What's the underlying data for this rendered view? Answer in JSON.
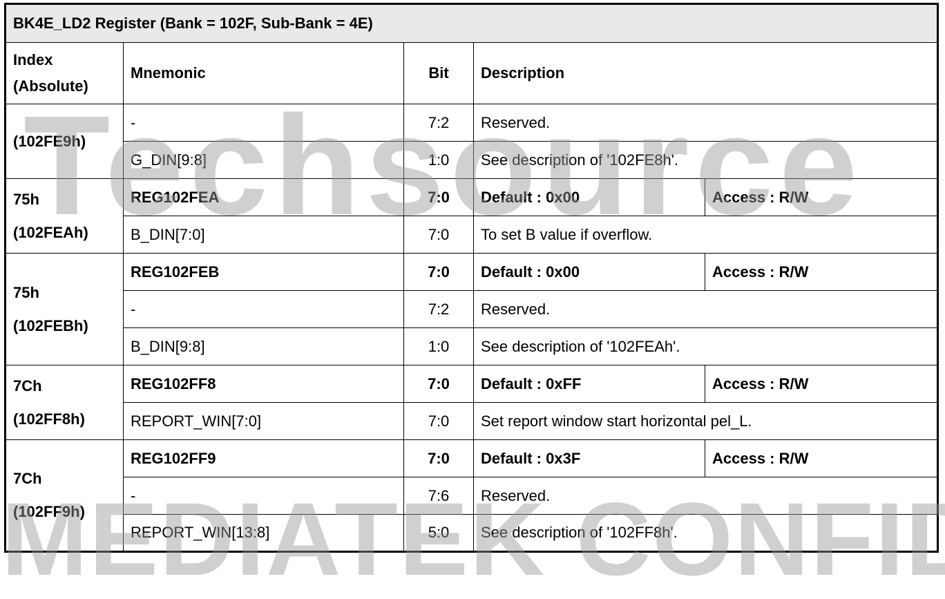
{
  "title": "BK4E_LD2 Register (Bank = 102F, Sub-Bank = 4E)",
  "headers": {
    "index_line1": "Index",
    "index_line2": "(Absolute)",
    "mnemonic": "Mnemonic",
    "bit": "Bit",
    "description": "Description"
  },
  "rows": [
    {
      "mnemonic": "-",
      "bit": "7:2",
      "desc": "Reserved."
    },
    {
      "mnemonic": "G_DIN[9:8]",
      "bit": "1:0",
      "desc": "See description of '102FE8h'."
    },
    {
      "mnemonic": "REG102FEA",
      "bit": "7:0",
      "default": "Default : 0x00",
      "access": "Access : R/W"
    },
    {
      "mnemonic": "B_DIN[7:0]",
      "bit": "7:0",
      "desc": "To set B value if overflow."
    },
    {
      "mnemonic": "REG102FEB",
      "bit": "7:0",
      "default": "Default : 0x00",
      "access": "Access : R/W"
    },
    {
      "mnemonic": "-",
      "bit": "7:2",
      "desc": "Reserved."
    },
    {
      "mnemonic": "B_DIN[9:8]",
      "bit": "1:0",
      "desc": "See description of '102FEAh'."
    },
    {
      "mnemonic": "REG102FF8",
      "bit": "7:0",
      "default": "Default : 0xFF",
      "access": "Access : R/W"
    },
    {
      "mnemonic": "REPORT_WIN[7:0]",
      "bit": "7:0",
      "desc": "Set report window start horizontal pel_L."
    },
    {
      "mnemonic": "REG102FF9",
      "bit": "7:0",
      "default": "Default : 0x3F",
      "access": "Access : R/W"
    },
    {
      "mnemonic": "-",
      "bit": "7:6",
      "desc": "Reserved."
    },
    {
      "mnemonic": "REPORT_WIN[13:8]",
      "bit": "5:0",
      "desc": "See description of '102FF8h'."
    }
  ],
  "indexes": [
    {
      "line1": "(102FE9h)",
      "line2": ""
    },
    {
      "line1": "75h",
      "line2": "(102FEAh)"
    },
    {
      "line1": "75h",
      "line2": "(102FEBh)"
    },
    {
      "line1": "7Ch",
      "line2": "(102FF8h)"
    },
    {
      "line1": "7Ch",
      "line2": "(102FF9h)"
    }
  ],
  "watermarks": {
    "top": "Techsource",
    "bottom": "MEDIATEK CONFIDENTIAL"
  }
}
